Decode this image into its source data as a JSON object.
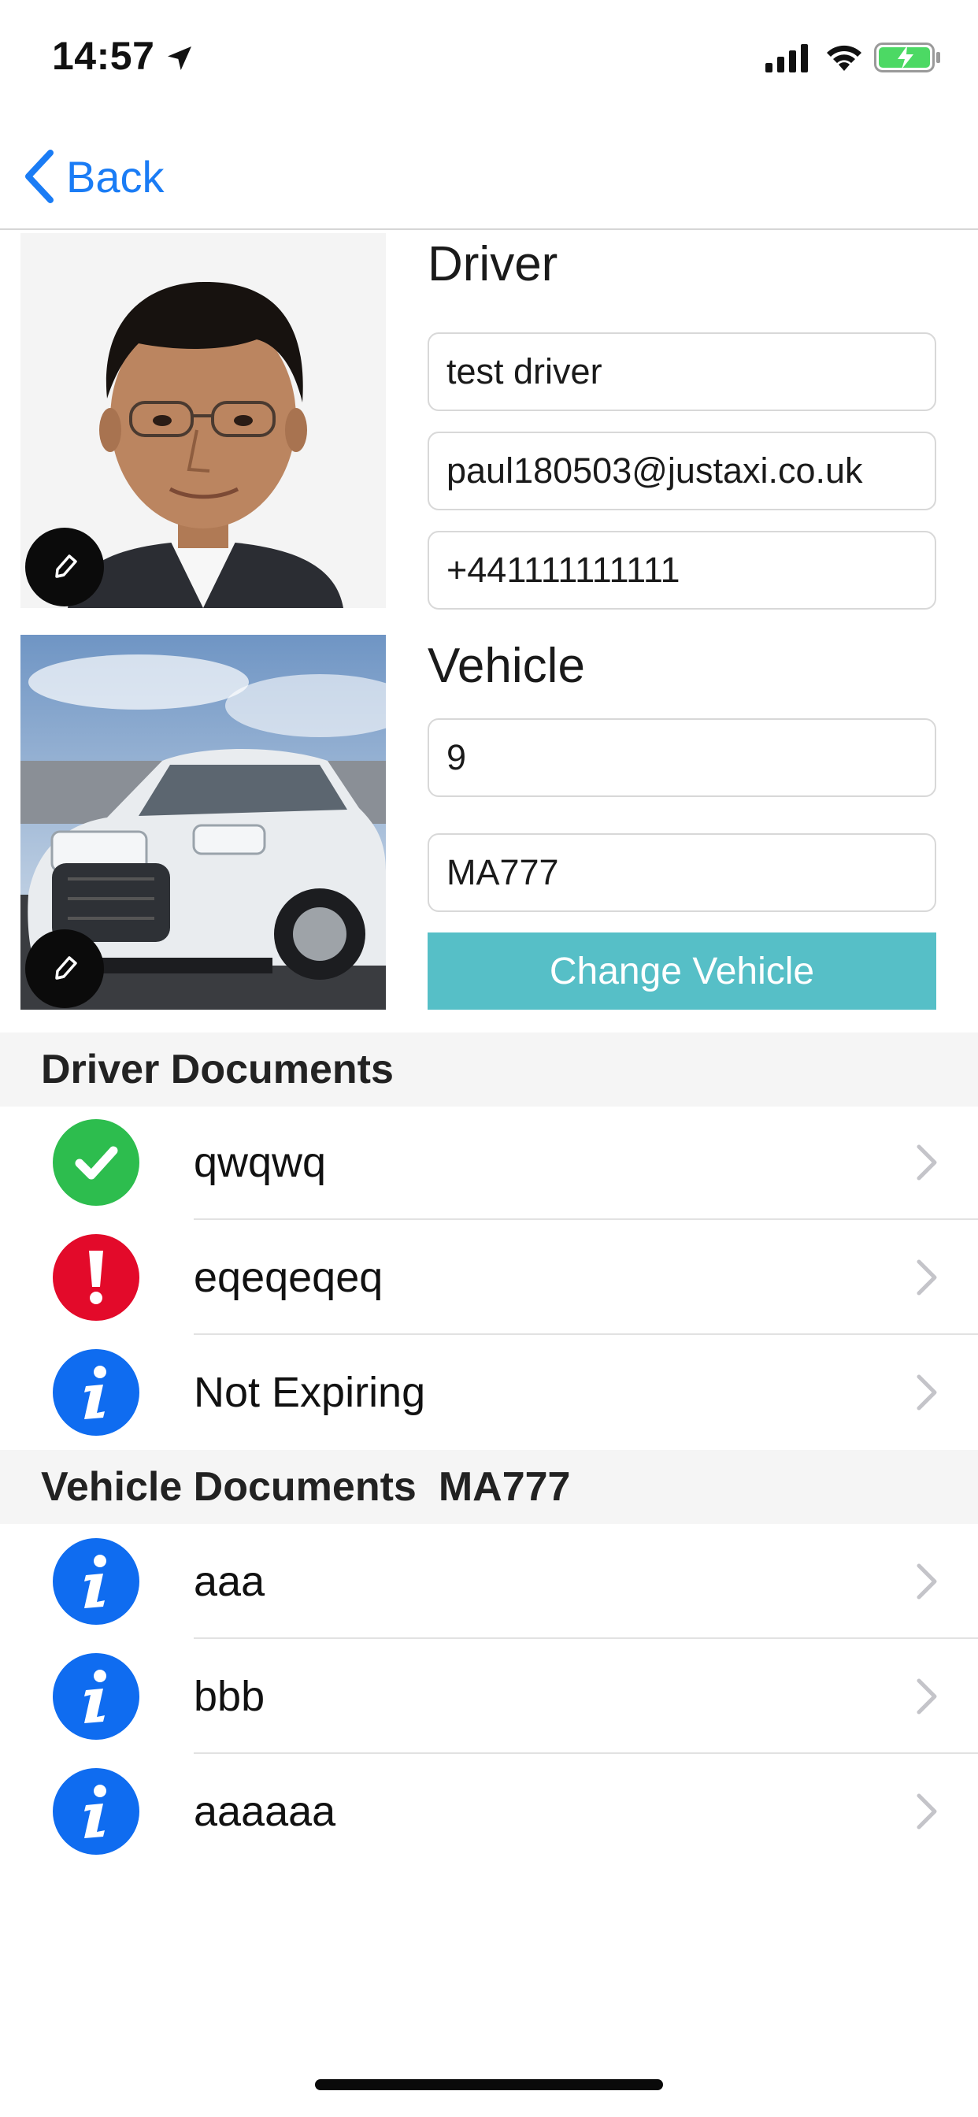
{
  "status_bar": {
    "time": "14:57",
    "icons": [
      "location-arrow-icon",
      "signal-icon",
      "wifi-icon",
      "battery-charging-icon"
    ],
    "battery_color": "#4cd964"
  },
  "nav": {
    "back_label": "Back",
    "accent_color": "#1a7cf5"
  },
  "driver": {
    "heading": "Driver",
    "name": "test driver",
    "email": "paul180503@justaxi.co.uk",
    "phone": "+441111111111"
  },
  "vehicle": {
    "heading": "Vehicle",
    "number": "9",
    "plate": "MA777",
    "change_button_label": "Change Vehicle",
    "button_color": "#56bfc7"
  },
  "driver_documents": {
    "header": "Driver Documents",
    "items": [
      {
        "label": "qwqwq",
        "status_icon": "check-icon",
        "color": "#2dbd4e"
      },
      {
        "label": "eqeqeqeq",
        "status_icon": "exclamation-icon",
        "color": "#e30a2a"
      },
      {
        "label": "Not Expiring",
        "status_icon": "info-icon",
        "color": "#0f6cf0"
      }
    ]
  },
  "vehicle_documents": {
    "header": "Vehicle Documents",
    "plate": "MA777",
    "items": [
      {
        "label": "aaa",
        "status_icon": "info-icon",
        "color": "#0f6cf0"
      },
      {
        "label": "bbb",
        "status_icon": "info-icon",
        "color": "#0f6cf0"
      },
      {
        "label": "aaaaaa",
        "status_icon": "info-icon",
        "color": "#0f6cf0"
      }
    ]
  }
}
